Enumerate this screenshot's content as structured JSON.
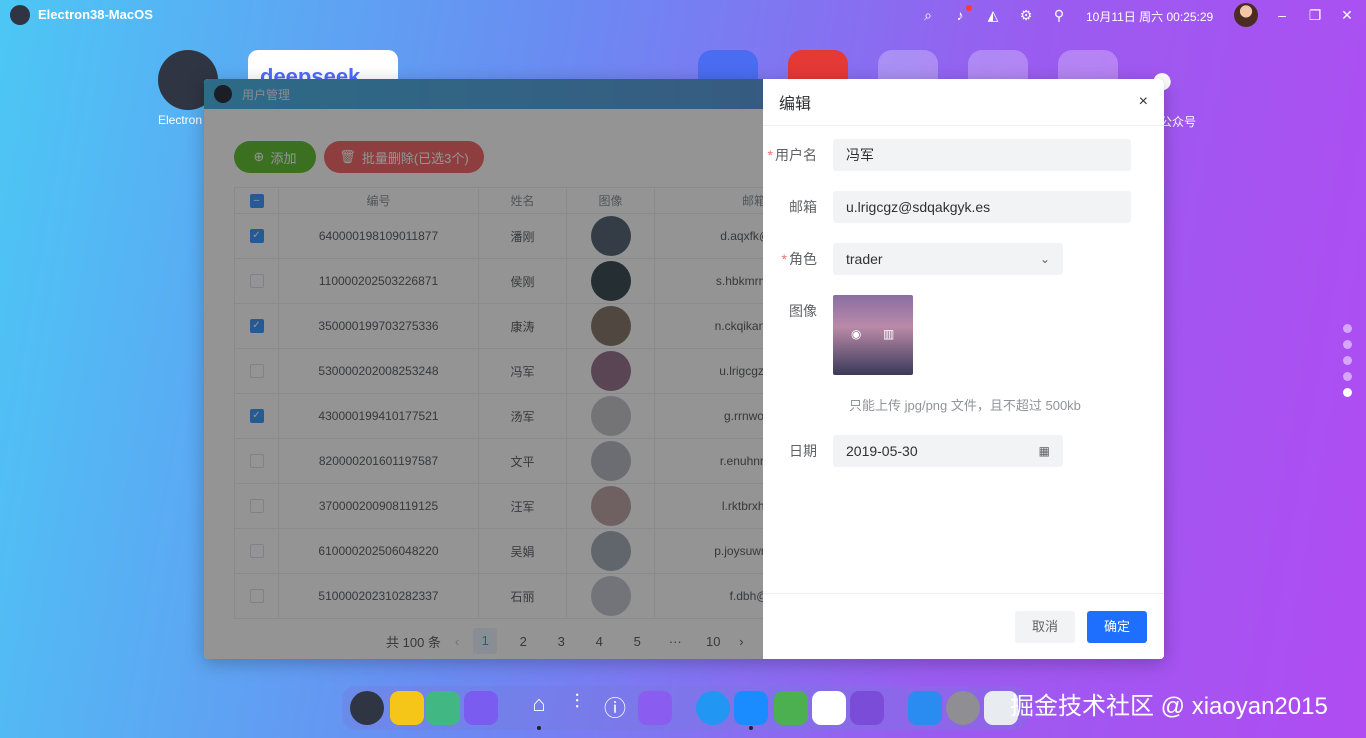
{
  "topbar": {
    "app_title": "Electron38-MacOS",
    "datetime": "10月11日 周六 00:25:29"
  },
  "desktop": {
    "icons": [
      {
        "label": "Electron"
      },
      {
        "label": "deepseek"
      },
      {
        "label": ""
      },
      {
        "label": ""
      },
      {
        "label": ""
      },
      {
        "label": ""
      },
      {
        "label": ""
      },
      {
        "label": ""
      },
      {
        "label": ""
      },
      {
        "label": "公众号"
      }
    ]
  },
  "window": {
    "title": "用户管理",
    "toolbar": {
      "add_label": "添加",
      "batch_delete_label": "批量删除(已选3个)"
    },
    "table": {
      "headers": [
        "编号",
        "姓名",
        "图像",
        "邮箱"
      ],
      "rows": [
        {
          "id": "640000198109011877",
          "name": "潘刚",
          "email": "d.aqxfk@mo",
          "checked": true
        },
        {
          "id": "110000202503226871",
          "name": "侯刚",
          "email": "s.hbkmrmvj@j",
          "checked": false
        },
        {
          "id": "350000199703275336",
          "name": "康涛",
          "email": "n.ckqikanr@cx",
          "checked": true
        },
        {
          "id": "530000202008253248",
          "name": "冯军",
          "email": "u.lrigcgz@sd",
          "checked": false
        },
        {
          "id": "430000199410177521",
          "name": "汤军",
          "email": "g.rrnwogud",
          "checked": true
        },
        {
          "id": "820000201601197587",
          "name": "文平",
          "email": "r.enuhnnf@c",
          "checked": false
        },
        {
          "id": "370000200908119125",
          "name": "汪军",
          "email": "l.rktbrxh@lh",
          "checked": false
        },
        {
          "id": "610000202506048220",
          "name": "吴娟",
          "email": "p.joysuwrhtq@",
          "checked": false
        },
        {
          "id": "510000202310282337",
          "name": "石丽",
          "email": "f.dbh@irt",
          "checked": false
        }
      ]
    },
    "pager": {
      "total": "共 100 条",
      "prev": "‹",
      "pages": [
        "1",
        "2",
        "3",
        "4",
        "5",
        "···",
        "10"
      ],
      "next": "›"
    }
  },
  "drawer": {
    "title": "编辑",
    "close": "×",
    "fields": {
      "username_label": "用户名",
      "username_value": "冯军",
      "email_label": "邮箱",
      "email_value": "u.lrigcgz@sdqakgyk.es",
      "role_label": "角色",
      "role_value": "trader",
      "image_label": "图像",
      "upload_hint": "只能上传 jpg/png 文件，且不超过 500kb",
      "date_label": "日期",
      "date_value": "2019-05-30"
    },
    "cancel_label": "取消",
    "confirm_label": "确定"
  },
  "watermark": "掘金技术社区 @ xiaoyan2015"
}
